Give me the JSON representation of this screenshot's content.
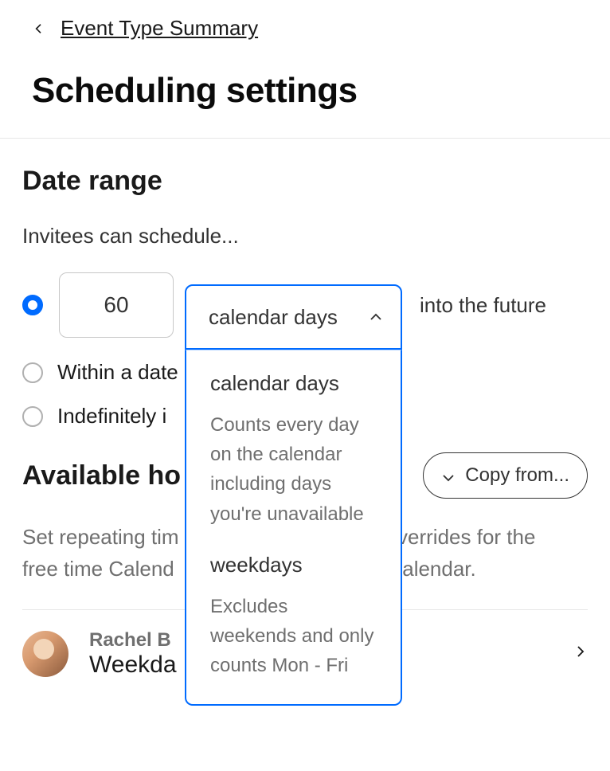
{
  "breadcrumb": {
    "back_label": "Event Type Summary"
  },
  "page_title": "Scheduling settings",
  "date_range": {
    "title": "Date range",
    "lead": "Invitees can schedule...",
    "days_value": "60",
    "selected_unit": "calendar days",
    "trail": "into the future",
    "option_within": "Within a date",
    "option_indef": "Indefinitely i",
    "dropdown": {
      "options": [
        {
          "title": "calendar days",
          "desc": "Counts every day on the calendar including days you're unavailable"
        },
        {
          "title": "weekdays",
          "desc": "Excludes weekends and only counts Mon - Fri"
        }
      ]
    }
  },
  "available": {
    "title": "Available ho",
    "copy_label": "Copy from...",
    "description_a": "Set repeating tim",
    "description_b": "verrides for the",
    "description_c": "free time Calend",
    "description_d": "alendar."
  },
  "person": {
    "name": "Rachel B",
    "schedule": "Weekda"
  }
}
